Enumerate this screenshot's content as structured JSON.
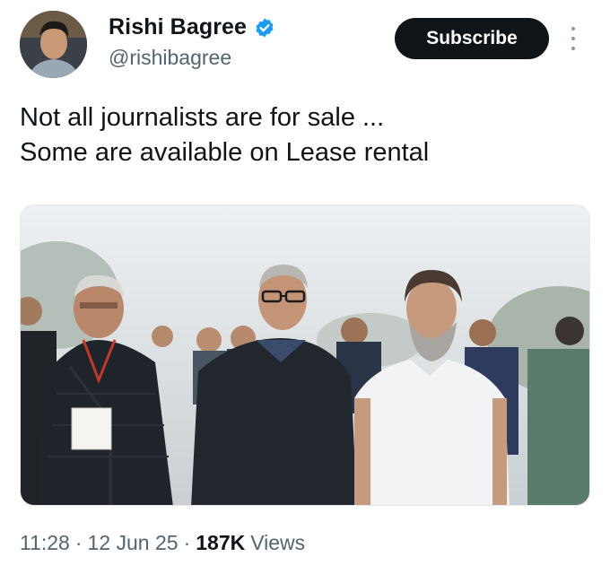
{
  "author": {
    "display_name": "Rishi Bagree",
    "handle": "@rishibagree",
    "verified": true,
    "avatar_icon": "profile-photo"
  },
  "actions": {
    "subscribe_label": "Subscribe",
    "more_icon": "more-vertical-icon"
  },
  "tweet": {
    "lines": [
      "Not all journalists are for sale ...",
      "Some are available on Lease rental"
    ]
  },
  "media": {
    "kind": "photo"
  },
  "meta": {
    "time": "11:28",
    "separator": "·",
    "date": "12 Jun 25",
    "views_count": "187K",
    "views_label": "Views"
  },
  "colors": {
    "text": "#0f1419",
    "secondary": "#536471",
    "verified_badge": "#1d9bf0",
    "button_bg": "#0f1419",
    "button_text": "#ffffff"
  }
}
